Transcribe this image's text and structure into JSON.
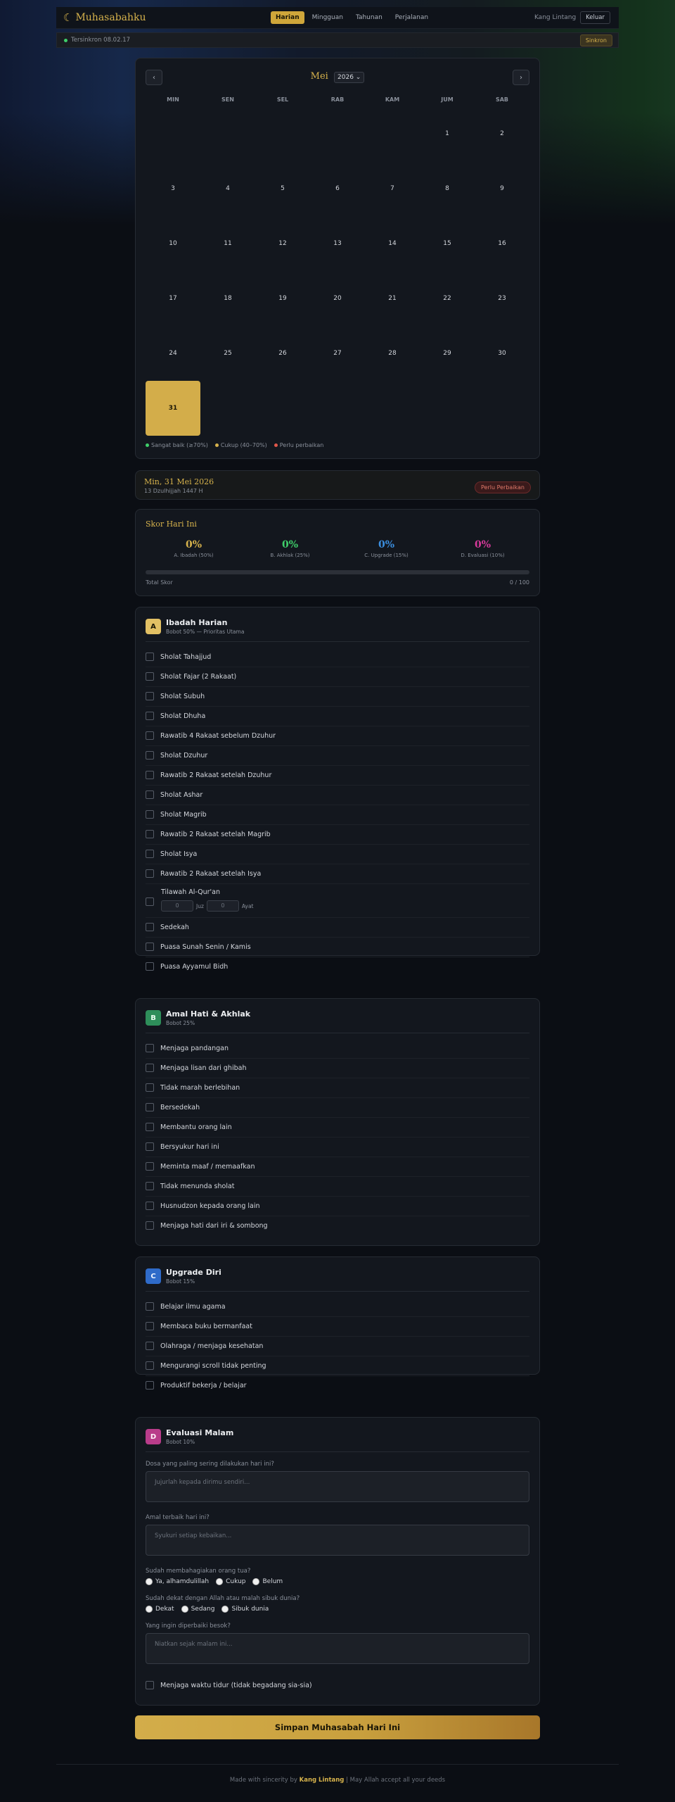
{
  "header": {
    "brand": "Muhasabahku",
    "tabs": [
      "Harian",
      "Mingguan",
      "Tahunan",
      "Perjalanan"
    ],
    "active_tab": 0,
    "user": "Kang Lintang",
    "logout": "Keluar"
  },
  "sync": {
    "status": "Tersinkron 08.02.17",
    "button": "Sinkron"
  },
  "calendar": {
    "month": "Mei",
    "year": "2026",
    "prev": "‹",
    "next": "›",
    "weekdays": [
      "MIN",
      "SEN",
      "SEL",
      "RAB",
      "KAM",
      "JUM",
      "SAB"
    ],
    "first_weekday_index": 5,
    "days_in_month": 31,
    "selected_day": 31,
    "legend": [
      {
        "label": "Sangat baik (≥70%)",
        "color": "#3fcf6a"
      },
      {
        "label": "Cukup (40–70%)",
        "color": "#d6b24c"
      },
      {
        "label": "Perlu perbaikan",
        "color": "#e0574a"
      }
    ]
  },
  "selected_date": {
    "gregorian": "Min, 31 Mei 2026",
    "hijri": "13 Dzulhijjah 1447 H",
    "badge": "Perlu Perbaikan"
  },
  "score": {
    "title": "Skor Hari Ini",
    "items": [
      {
        "value": "0%",
        "label": "A. Ibadah (50%)",
        "color": "#d6b24c"
      },
      {
        "value": "0%",
        "label": "B. Akhlak (25%)",
        "color": "#3fcf6a"
      },
      {
        "value": "0%",
        "label": "C. Upgrade (15%)",
        "color": "#3b8fe0"
      },
      {
        "value": "0%",
        "label": "D. Evaluasi (10%)",
        "color": "#d6399a"
      }
    ],
    "total_label": "Total Skor",
    "total_value": "0 / 100",
    "total_fraction": 0
  },
  "sections": {
    "a": {
      "letter": "A",
      "title": "Ibadah Harian",
      "subtitle": "Bobot 50% — Prioritas Utama",
      "items_before": [
        "Sholat Tahajjud",
        "Sholat Fajar (2 Rakaat)",
        "Sholat Subuh",
        "Sholat Dhuha",
        "Rawatib 4 Rakaat sebelum Dzuhur",
        "Sholat Dzuhur",
        "Rawatib 2 Rakaat setelah Dzuhur",
        "Sholat Ashar",
        "Sholat Magrib",
        "Rawatib 2 Rakaat setelah Magrib",
        "Sholat Isya",
        "Rawatib 2 Rakaat setelah Isya"
      ],
      "quran": {
        "label": "Tilawah Al-Qur'an",
        "juz_placeholder": "0",
        "juz_unit": "Juz",
        "ayat_placeholder": "0",
        "ayat_unit": "Ayat"
      },
      "items_after": [
        "Sedekah",
        "Puasa Sunah Senin / Kamis",
        "Puasa Ayyamul Bidh"
      ]
    },
    "b": {
      "letter": "B",
      "title": "Amal Hati & Akhlak",
      "subtitle": "Bobot 25%",
      "items": [
        "Menjaga pandangan",
        "Menjaga lisan dari ghibah",
        "Tidak marah berlebihan",
        "Bersedekah",
        "Membantu orang lain",
        "Bersyukur hari ini",
        "Meminta maaf / memaafkan",
        "Tidak menunda sholat",
        "Husnudzon kepada orang lain",
        "Menjaga hati dari iri & sombong"
      ]
    },
    "c": {
      "letter": "C",
      "title": "Upgrade Diri",
      "subtitle": "Bobot 15%",
      "items": [
        "Belajar ilmu agama",
        "Membaca buku bermanfaat",
        "Olahraga / menjaga kesehatan",
        "Mengurangi scroll tidak penting",
        "Produktif bekerja / belajar"
      ]
    },
    "d": {
      "letter": "D",
      "title": "Evaluasi Malam",
      "subtitle": "Bobot 10%",
      "q1_label": "Dosa yang paling sering dilakukan hari ini?",
      "q1_placeholder": "Jujurlah kepada dirimu sendiri...",
      "q2_label": "Amal terbaik hari ini?",
      "q2_placeholder": "Syukuri setiap kebaikan...",
      "q3_label": "Sudah membahagiakan orang tua?",
      "q3_options": [
        "Ya, alhamdulillah",
        "Cukup",
        "Belum"
      ],
      "q4_label": "Sudah dekat dengan Allah atau malah sibuk dunia?",
      "q4_options": [
        "Dekat",
        "Sedang",
        "Sibuk dunia"
      ],
      "q5_label": "Yang ingin diperbaiki besok?",
      "q5_placeholder": "Niatkan sejak malam ini...",
      "sleep_item": "Menjaga waktu tidur (tidak begadang sia-sia)"
    }
  },
  "save_button": "Simpan Muhasabah Hari Ini",
  "footer": {
    "prefix": "Made with sincerity by",
    "author": "Kang Lintang",
    "suffix": "| May Allah accept all your deeds"
  }
}
